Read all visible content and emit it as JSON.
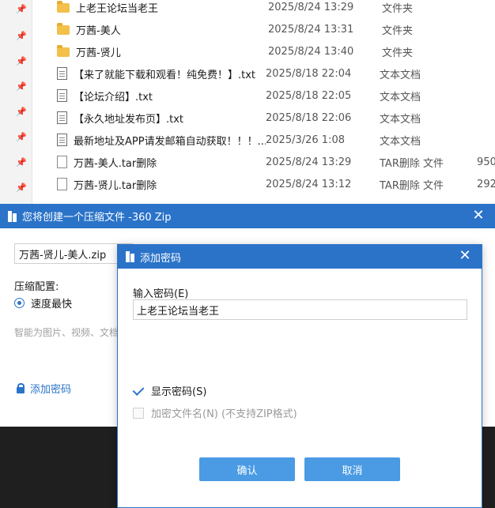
{
  "explorer": {
    "files": [
      {
        "name": "上老王论坛当老王",
        "date": "2025/8/24 13:29",
        "type": "文件夹",
        "size": "",
        "icon": "folder-icon"
      },
      {
        "name": "万茜-美人",
        "date": "2025/8/24 13:31",
        "type": "文件夹",
        "size": "",
        "icon": "folder-icon"
      },
      {
        "name": "万茜-贤儿",
        "date": "2025/8/24 13:40",
        "type": "文件夹",
        "size": "",
        "icon": "folder-icon"
      },
      {
        "name": "【来了就能下载和观看！纯免费！】.txt",
        "date": "2025/8/18 22:04",
        "type": "文本文档",
        "size": "",
        "icon": "text-file-icon"
      },
      {
        "name": "【论坛介绍】.txt",
        "date": "2025/8/18 22:05",
        "type": "文本文档",
        "size": "",
        "icon": "text-file-icon"
      },
      {
        "name": "【永久地址发布页】.txt",
        "date": "2025/8/18 22:06",
        "type": "文本文档",
        "size": "",
        "icon": "text-file-icon"
      },
      {
        "name": "最新地址及APP请发邮箱自动获取！！！....",
        "date": "2025/3/26 1:08",
        "type": "文本文档",
        "size": "",
        "icon": "text-file-icon"
      },
      {
        "name": "万茜-美人.tar删除",
        "date": "2025/8/24 13:29",
        "type": "TAR删除 文件",
        "size": "950,",
        "icon": "file-icon"
      },
      {
        "name": "万茜-贤儿.tar删除",
        "date": "2025/8/24 13:12",
        "type": "TAR删除 文件",
        "size": "292,",
        "icon": "file-icon"
      }
    ]
  },
  "main_dialog": {
    "title": "您将创建一个压缩文件 -360 Zip",
    "archive_name": "万茜-贤儿-美人.zip",
    "config_label": "压缩配置:",
    "speed_option": "速度最快",
    "hint": "智能为图片、视频、文档",
    "add_password": "添加密码"
  },
  "password_dialog": {
    "title": "添加密码",
    "input_label": "输入密码(E)",
    "password_value": "上老王论坛当老王",
    "show_password": "显示密码(S)",
    "show_password_checked": true,
    "encrypt_names": "加密文件名(N) (不支持ZIP格式)",
    "encrypt_names_enabled": false,
    "confirm_label": "确认",
    "cancel_label": "取消"
  },
  "colors": {
    "accent": "#2a73c9",
    "button": "#4a9be4",
    "folder": "#f3c04a"
  }
}
